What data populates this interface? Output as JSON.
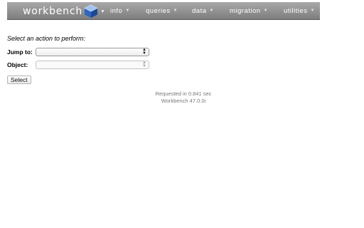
{
  "header": {
    "logo_text": "workbench",
    "logo_icon": "cube-icon",
    "menus": [
      {
        "label": "info"
      },
      {
        "label": "queries"
      },
      {
        "label": "data"
      },
      {
        "label": "migration"
      },
      {
        "label": "utilities"
      }
    ],
    "caret_icon": "caret-down-icon",
    "colors": {
      "bar_top": "#a9a9a9",
      "bar_bottom": "#7d7d7d",
      "cube": "#2e66c2"
    }
  },
  "main": {
    "prompt": "Select an action to perform:",
    "jump_to": {
      "label": "Jump to:",
      "value": ""
    },
    "object": {
      "label": "Object:",
      "value": ""
    },
    "select_button": "Select"
  },
  "footer": {
    "request_time": "Requested in 0.841 sec",
    "version": "Workbench 47.0.0i"
  }
}
